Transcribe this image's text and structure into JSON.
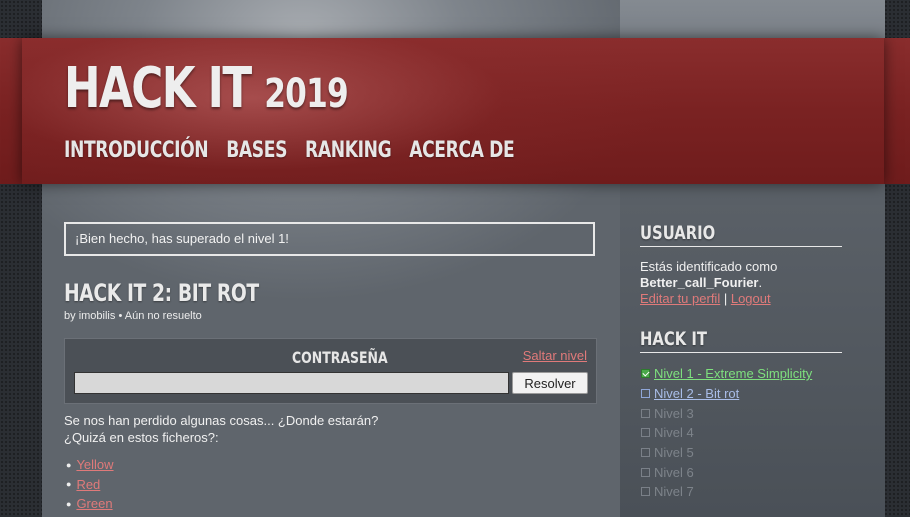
{
  "header": {
    "title": "HACK IT",
    "year": "2019",
    "nav": [
      "INTRODUCCIÓN",
      "BASES",
      "RANKING",
      "ACERCA DE"
    ]
  },
  "alert": {
    "message": "¡Bien hecho, has superado el nivel 1!"
  },
  "level": {
    "title": "HACK IT 2: BIT ROT",
    "author_prefix": "by",
    "author": "imobilis",
    "separator": "•",
    "status": "Aún no resuelto"
  },
  "password_box": {
    "label": "CONTRASEÑA",
    "skip_label": "Saltar nivel",
    "input_value": "",
    "submit_label": "Resolver"
  },
  "description": {
    "line1": "Se nos han perdido algunas cosas... ¿Donde estarán?",
    "line2": "¿Quizá en estos ficheros?:"
  },
  "files": [
    "Yellow",
    "Red",
    "Green"
  ],
  "sidebar": {
    "user": {
      "heading": "USUARIO",
      "logged_as": "Estás identificado como",
      "username": "Better_call_Fourier",
      "username_suffix": ".",
      "edit_profile": "Editar tu perfil",
      "separator": "|",
      "logout": "Logout"
    },
    "hackit": {
      "heading": "HACK IT",
      "levels": [
        {
          "label": "Nivel 1 - Extreme Simplicity",
          "state": "done"
        },
        {
          "label": "Nivel 2 - Bit rot",
          "state": "current"
        },
        {
          "label": "Nivel 3",
          "state": "locked"
        },
        {
          "label": "Nivel 4",
          "state": "locked"
        },
        {
          "label": "Nivel 5",
          "state": "locked"
        },
        {
          "label": "Nivel 6",
          "state": "locked"
        },
        {
          "label": "Nivel 7",
          "state": "locked"
        }
      ]
    }
  },
  "colors": {
    "banner_red": "#7a2222",
    "link_red": "#e07a7a",
    "solved_green": "#7ee07e",
    "current_blue": "#a9bde8"
  }
}
